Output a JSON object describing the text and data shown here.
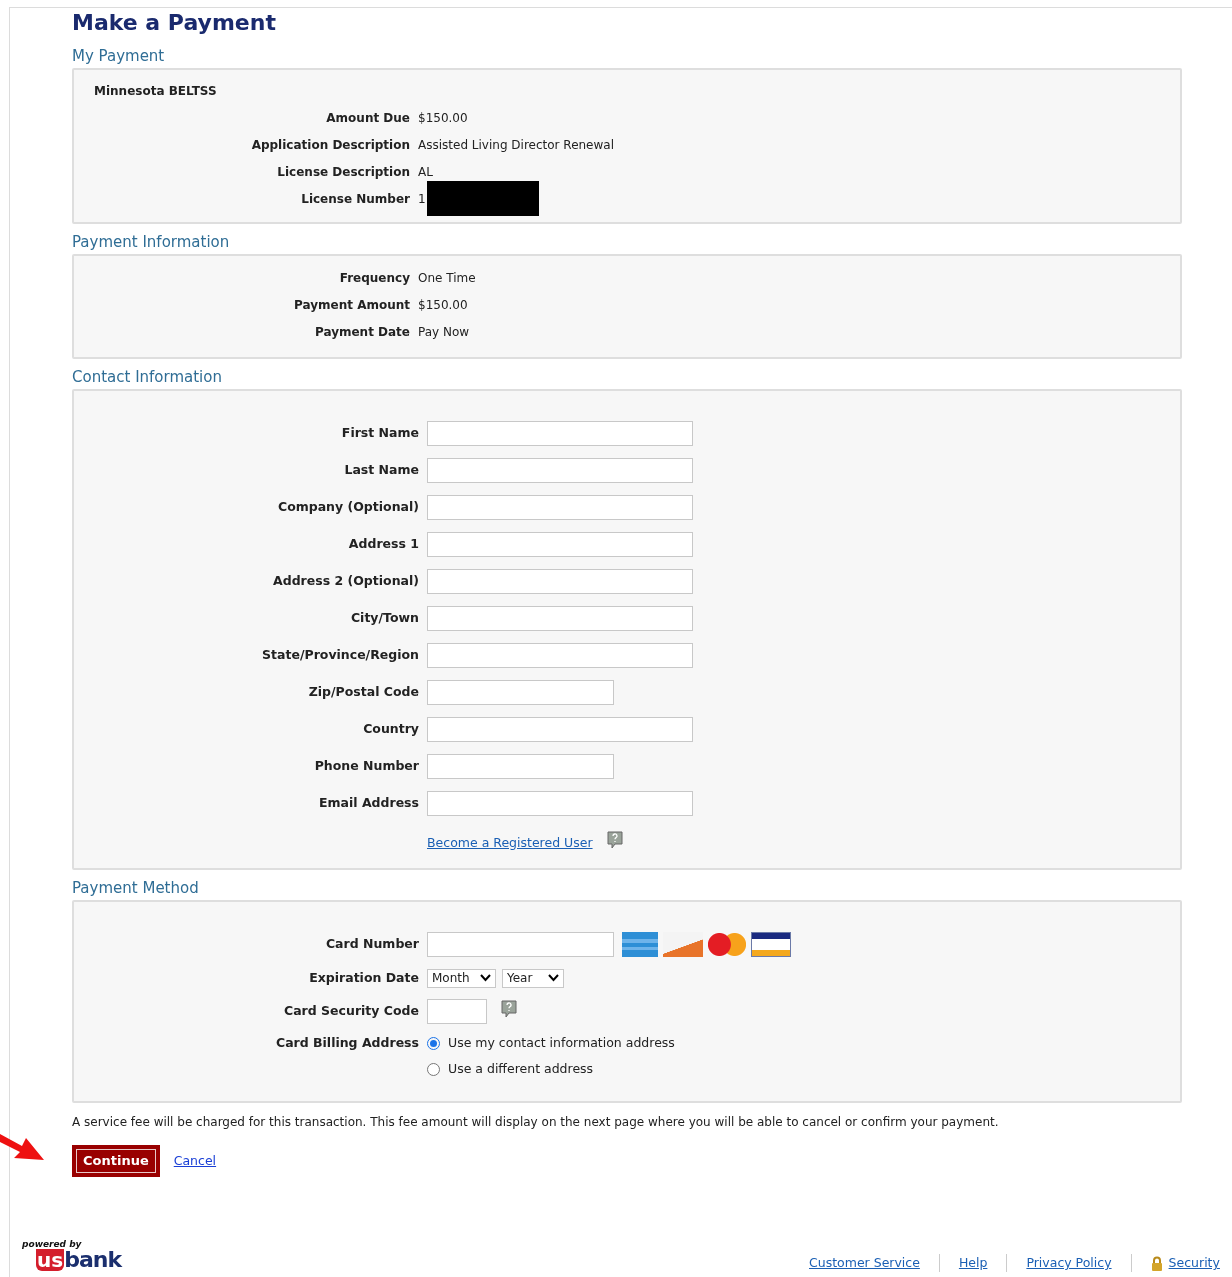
{
  "page_title": "Make a Payment",
  "my_payment": {
    "heading": "My Payment",
    "org": "Minnesota BELTSS",
    "rows": [
      {
        "label": "Amount Due",
        "value": "$150.00",
        "redacted": false
      },
      {
        "label": "Application Description",
        "value": "Assisted Living Director Renewal",
        "redacted": false
      },
      {
        "label": "License Description",
        "value": "AL",
        "redacted": false
      },
      {
        "label": "License Number",
        "value": "1",
        "redacted": true
      }
    ]
  },
  "payment_information": {
    "heading": "Payment Information",
    "rows": [
      {
        "label": "Frequency",
        "value": "One Time"
      },
      {
        "label": "Payment Amount",
        "value": "$150.00"
      },
      {
        "label": "Payment Date",
        "value": "Pay Now"
      }
    ]
  },
  "contact_information": {
    "heading": "Contact Information",
    "fields": [
      {
        "label": "First Name",
        "kind": "long"
      },
      {
        "label": "Last Name",
        "kind": "long"
      },
      {
        "label": "Company (Optional)",
        "kind": "long"
      },
      {
        "label": "Address 1",
        "kind": "long"
      },
      {
        "label": "Address 2 (Optional)",
        "kind": "long"
      },
      {
        "label": "City/Town",
        "kind": "long"
      },
      {
        "label": "State/Province/Region",
        "kind": "long"
      },
      {
        "label": "Zip/Postal Code",
        "kind": "short"
      },
      {
        "label": "Country",
        "kind": "long"
      },
      {
        "label": "Phone Number",
        "kind": "short"
      },
      {
        "label": "Email Address",
        "kind": "long"
      }
    ],
    "register_link": "Become a Registered User"
  },
  "payment_method": {
    "heading": "Payment Method",
    "card_number_label": "Card Number",
    "card_logos": [
      {
        "kind": "amex"
      },
      {
        "kind": "discover"
      },
      {
        "kind": "mastercard"
      },
      {
        "kind": "visa"
      }
    ],
    "expiration_label": "Expiration Date",
    "month": "Month",
    "year": "Year",
    "security_label": "Card Security Code",
    "billing_label": "Card Billing Address",
    "billing_options": [
      {
        "label": "Use my contact information address",
        "selected": true
      },
      {
        "label": "Use a different address",
        "selected": false
      }
    ]
  },
  "notice": "A service fee will be charged for this transaction. This fee amount will display on the next page where you will be able to cancel or confirm your payment.",
  "buttons": {
    "continue": "Continue",
    "cancel": "Cancel"
  },
  "footer": {
    "logo": {
      "tagline": "powered by",
      "mark": "us",
      "name": "bank"
    },
    "links": [
      {
        "label": "Customer Service",
        "kind": "link"
      },
      {
        "label": "Help",
        "kind": "link"
      },
      {
        "label": "Privacy Policy",
        "kind": "link"
      },
      {
        "label": "Security",
        "kind": "lock"
      }
    ]
  }
}
